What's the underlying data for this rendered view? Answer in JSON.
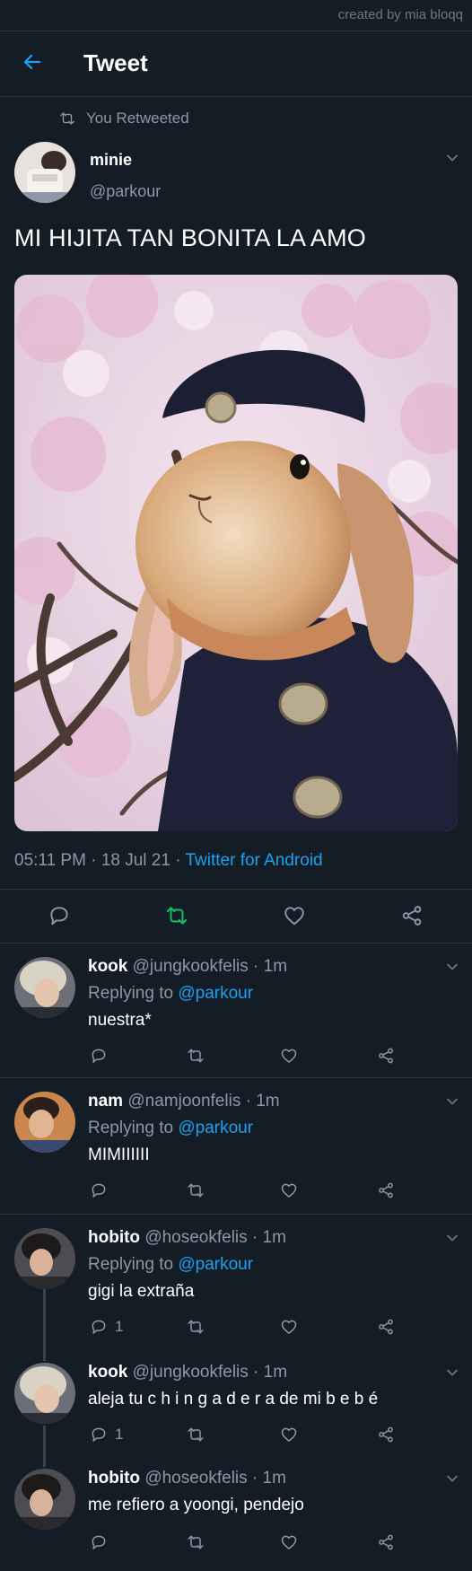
{
  "watermark": "created by mia bloqq",
  "header": {
    "title": "Tweet"
  },
  "retweet_note": "You Retweeted",
  "tweet": {
    "author_name": "minie",
    "author_handle": "@parkour",
    "text": "MI HIJITA TAN BONITA LA AMO",
    "time": "05:11 PM",
    "date": "18 Jul 21",
    "source": "Twitter for Android"
  },
  "colors": {
    "background": "#141d26",
    "accent": "#1da1f2",
    "retweet_active": "#17bf63",
    "muted": "#8b98a5"
  },
  "replies": [
    {
      "name": "kook",
      "handle": "@jungkookfelis",
      "age": "1m",
      "replying_label": "Replying to",
      "replying_to": "@parkour",
      "text": "nuestra*",
      "reply_count": ""
    },
    {
      "name": "nam",
      "handle": "@namjoonfelis",
      "age": "1m",
      "replying_label": "Replying to",
      "replying_to": "@parkour",
      "text": "MIMIIIIII",
      "reply_count": ""
    },
    {
      "name": "hobito",
      "handle": "@hoseokfelis",
      "age": "1m",
      "replying_label": "Replying to",
      "replying_to": "@parkour",
      "text": "gigi la extraña",
      "reply_count": "1"
    },
    {
      "name": "kook",
      "handle": "@jungkookfelis",
      "age": "1m",
      "text": "aleja tu c h i n g a d e r a de mi b e b é",
      "reply_count": "1"
    },
    {
      "name": "hobito",
      "handle": "@hoseokfelis",
      "age": "1m",
      "text": "me refiero a yoongi, pendejo",
      "reply_count": ""
    }
  ]
}
